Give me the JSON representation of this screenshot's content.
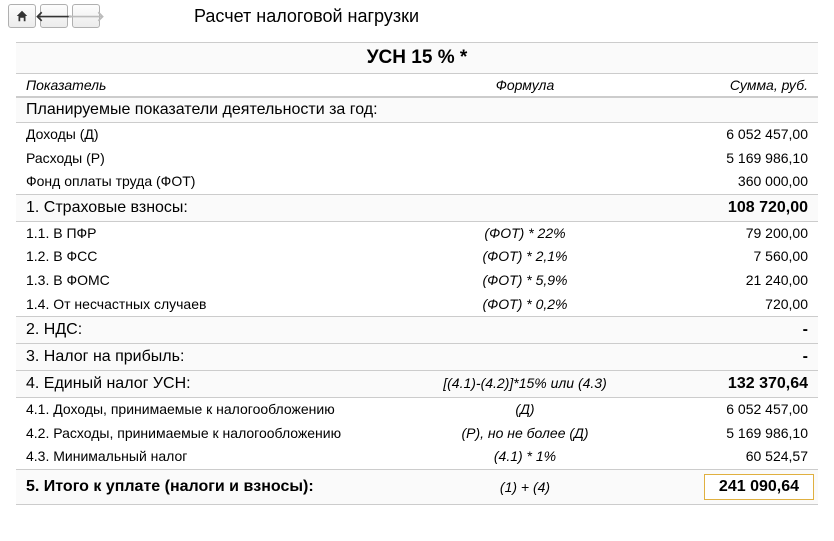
{
  "title": "Расчет налоговой нагрузки",
  "main_header": "УСН 15 % *",
  "cols": {
    "left": "Показатель",
    "mid": "Формула",
    "right": "Сумма, руб."
  },
  "planned_section": "Планируемые показатели деятельности за год:",
  "rows": {
    "income": {
      "label": "Доходы (Д)",
      "value": "6 052 457,00"
    },
    "expense": {
      "label": "Расходы (Р)",
      "value": "5 169 986,10"
    },
    "fot": {
      "label": "Фонд оплаты труда (ФОТ)",
      "value": "360 000,00"
    }
  },
  "s1": {
    "label": "1. Страховые взносы:",
    "value": "108 720,00"
  },
  "s11": {
    "label": "1.1. В ПФР",
    "formula": "(ФОТ) * 22%",
    "value": "79 200,00"
  },
  "s12": {
    "label": "1.2. В ФСС",
    "formula": "(ФОТ) * 2,1%",
    "value": "7 560,00"
  },
  "s13": {
    "label": "1.3. В ФОМС",
    "formula": "(ФОТ) * 5,9%",
    "value": "21 240,00"
  },
  "s14": {
    "label": "1.4. От несчастных случаев",
    "formula": "(ФОТ) * 0,2%",
    "value": "720,00"
  },
  "s2": {
    "label": "2. НДС:",
    "value": "-"
  },
  "s3": {
    "label": "3. Налог на прибыль:",
    "value": "-"
  },
  "s4": {
    "label": "4. Единый налог УСН:",
    "formula": "[(4.1)-(4.2)]*15% или (4.3)",
    "value": "132 370,64"
  },
  "s41": {
    "label": "4.1. Доходы, принимаемые к налогообложению",
    "formula": "(Д)",
    "value": "6 052 457,00"
  },
  "s42": {
    "label": "4.2. Расходы, принимаемые к налогообложению",
    "formula": "(Р), но не более (Д)",
    "value": "5 169 986,10"
  },
  "s43": {
    "label": "4.3. Минимальный налог",
    "formula": "(4.1) * 1%",
    "value": "60 524,57"
  },
  "s5": {
    "label": "5. Итого к уплате (налоги и взносы):",
    "formula": "(1) + (4)",
    "value": "241 090,64"
  }
}
